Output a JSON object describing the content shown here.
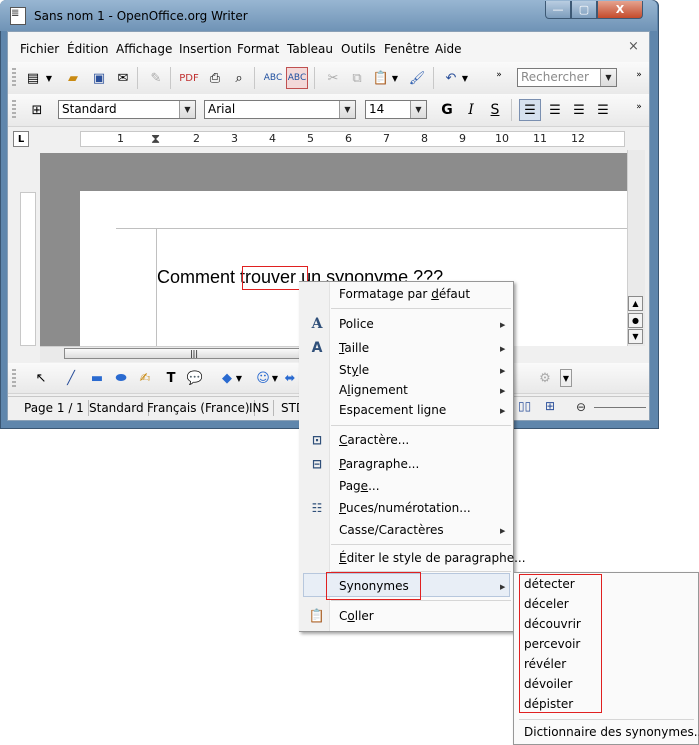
{
  "window": {
    "title": "Sans nom 1 - OpenOffice.org Writer",
    "controls": {
      "minimize": "—",
      "maximize": "▢",
      "close": "X"
    }
  },
  "menubar": {
    "items": [
      "Fichier",
      "Édition",
      "Affichage",
      "Insertion",
      "Format",
      "Tableau",
      "Outils",
      "Fenêtre",
      "Aide"
    ],
    "close": "×"
  },
  "toolbar_standard": {
    "search_placeholder": "Rechercher"
  },
  "toolbar_formatting": {
    "style": "Standard",
    "font": "Arial",
    "size": "14",
    "bold": "G",
    "italic": "I",
    "underline": "S"
  },
  "ruler": {
    "tab_selector": "L",
    "labels": [
      "1",
      "2",
      "3",
      "4",
      "5",
      "6",
      "7",
      "8",
      "9",
      "10",
      "11",
      "12"
    ]
  },
  "document": {
    "before": "Comment ",
    "word": "trouver",
    "after": " un synonyme ???"
  },
  "statusbar": {
    "page": "Page 1 / 1",
    "style": "Standard",
    "language": "Français (France)",
    "mode": "INS",
    "selection": "STD"
  },
  "context_menu": {
    "items": [
      {
        "label": "Formatage par défaut",
        "submenu": false,
        "icon": ""
      },
      {
        "label": "Police",
        "submenu": true,
        "icon": "font-icon"
      },
      {
        "label": "Taille",
        "submenu": true,
        "icon": "font-size-icon"
      },
      {
        "label": "Style",
        "submenu": true,
        "icon": ""
      },
      {
        "label": "Alignement",
        "submenu": true,
        "icon": ""
      },
      {
        "label": "Espacement ligne",
        "submenu": true,
        "icon": ""
      },
      {
        "label": "Caractère...",
        "submenu": false,
        "icon": "character-icon"
      },
      {
        "label": "Paragraphe...",
        "submenu": false,
        "icon": "paragraph-icon"
      },
      {
        "label": "Page...",
        "submenu": false,
        "icon": ""
      },
      {
        "label": "Puces/numérotation...",
        "submenu": false,
        "icon": "bullets-icon"
      },
      {
        "label": "Casse/Caractères",
        "submenu": true,
        "icon": ""
      },
      {
        "label": "Éditer le style de paragraphe...",
        "submenu": false,
        "icon": ""
      },
      {
        "label": "Synonymes",
        "submenu": true,
        "icon": ""
      },
      {
        "label": "Coller",
        "submenu": false,
        "icon": "paste-icon"
      }
    ]
  },
  "synonyms_menu": {
    "items": [
      "détecter",
      "déceler",
      "découvrir",
      "percevoir",
      "révéler",
      "dévoiler",
      "dépister"
    ],
    "dictionary": "Dictionnaire des synonymes..."
  },
  "colors": {
    "highlight_red": "#e02020",
    "title_bar": "#6f93b6",
    "menu_hover": "#e8eef6"
  }
}
